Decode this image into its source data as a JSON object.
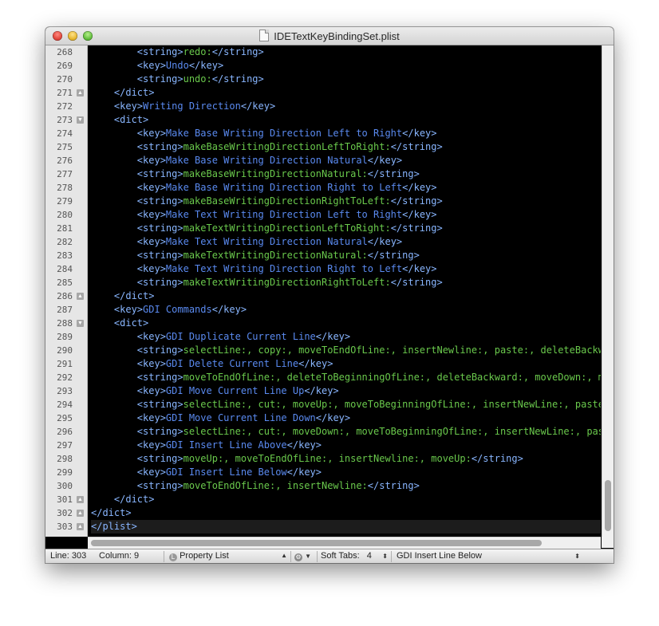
{
  "window": {
    "title": "IDETextKeyBindingSet.plist"
  },
  "editor": {
    "lines": [
      {
        "num": "268",
        "fold": "",
        "tokens": [
          {
            "t": "tag",
            "v": "        <string>"
          },
          {
            "t": "str",
            "v": "redo:"
          },
          {
            "t": "tag",
            "v": "</string>"
          }
        ]
      },
      {
        "num": "269",
        "fold": "",
        "tokens": [
          {
            "t": "tag",
            "v": "        <key>"
          },
          {
            "t": "txt",
            "v": "Undo"
          },
          {
            "t": "tag",
            "v": "</key>"
          }
        ]
      },
      {
        "num": "270",
        "fold": "",
        "tokens": [
          {
            "t": "tag",
            "v": "        <string>"
          },
          {
            "t": "str",
            "v": "undo:"
          },
          {
            "t": "tag",
            "v": "</string>"
          }
        ]
      },
      {
        "num": "271",
        "fold": "up",
        "tokens": [
          {
            "t": "tag",
            "v": "    </dict>"
          }
        ]
      },
      {
        "num": "272",
        "fold": "",
        "tokens": [
          {
            "t": "tag",
            "v": "    <key>"
          },
          {
            "t": "txt",
            "v": "Writing Direction"
          },
          {
            "t": "tag",
            "v": "</key>"
          }
        ]
      },
      {
        "num": "273",
        "fold": "down",
        "tokens": [
          {
            "t": "tag",
            "v": "    <dict>"
          }
        ]
      },
      {
        "num": "274",
        "fold": "",
        "tokens": [
          {
            "t": "tag",
            "v": "        <key>"
          },
          {
            "t": "txt",
            "v": "Make Base Writing Direction Left to Right"
          },
          {
            "t": "tag",
            "v": "</key>"
          }
        ]
      },
      {
        "num": "275",
        "fold": "",
        "tokens": [
          {
            "t": "tag",
            "v": "        <string>"
          },
          {
            "t": "str",
            "v": "makeBaseWritingDirectionLeftToRight:"
          },
          {
            "t": "tag",
            "v": "</string>"
          }
        ]
      },
      {
        "num": "276",
        "fold": "",
        "tokens": [
          {
            "t": "tag",
            "v": "        <key>"
          },
          {
            "t": "txt",
            "v": "Make Base Writing Direction Natural"
          },
          {
            "t": "tag",
            "v": "</key>"
          }
        ]
      },
      {
        "num": "277",
        "fold": "",
        "tokens": [
          {
            "t": "tag",
            "v": "        <string>"
          },
          {
            "t": "str",
            "v": "makeBaseWritingDirectionNatural:"
          },
          {
            "t": "tag",
            "v": "</string>"
          }
        ]
      },
      {
        "num": "278",
        "fold": "",
        "tokens": [
          {
            "t": "tag",
            "v": "        <key>"
          },
          {
            "t": "txt",
            "v": "Make Base Writing Direction Right to Left"
          },
          {
            "t": "tag",
            "v": "</key>"
          }
        ]
      },
      {
        "num": "279",
        "fold": "",
        "tokens": [
          {
            "t": "tag",
            "v": "        <string>"
          },
          {
            "t": "str",
            "v": "makeBaseWritingDirectionRightToLeft:"
          },
          {
            "t": "tag",
            "v": "</string>"
          }
        ]
      },
      {
        "num": "280",
        "fold": "",
        "tokens": [
          {
            "t": "tag",
            "v": "        <key>"
          },
          {
            "t": "txt",
            "v": "Make Text Writing Direction Left to Right"
          },
          {
            "t": "tag",
            "v": "</key>"
          }
        ]
      },
      {
        "num": "281",
        "fold": "",
        "tokens": [
          {
            "t": "tag",
            "v": "        <string>"
          },
          {
            "t": "str",
            "v": "makeTextWritingDirectionLeftToRight:"
          },
          {
            "t": "tag",
            "v": "</string>"
          }
        ]
      },
      {
        "num": "282",
        "fold": "",
        "tokens": [
          {
            "t": "tag",
            "v": "        <key>"
          },
          {
            "t": "txt",
            "v": "Make Text Writing Direction Natural"
          },
          {
            "t": "tag",
            "v": "</key>"
          }
        ]
      },
      {
        "num": "283",
        "fold": "",
        "tokens": [
          {
            "t": "tag",
            "v": "        <string>"
          },
          {
            "t": "str",
            "v": "makeTextWritingDirectionNatural:"
          },
          {
            "t": "tag",
            "v": "</string>"
          }
        ]
      },
      {
        "num": "284",
        "fold": "",
        "tokens": [
          {
            "t": "tag",
            "v": "        <key>"
          },
          {
            "t": "txt",
            "v": "Make Text Writing Direction Right to Left"
          },
          {
            "t": "tag",
            "v": "</key>"
          }
        ]
      },
      {
        "num": "285",
        "fold": "",
        "tokens": [
          {
            "t": "tag",
            "v": "        <string>"
          },
          {
            "t": "str",
            "v": "makeTextWritingDirectionRightToLeft:"
          },
          {
            "t": "tag",
            "v": "</string>"
          }
        ]
      },
      {
        "num": "286",
        "fold": "up",
        "tokens": [
          {
            "t": "tag",
            "v": "    </dict>"
          }
        ]
      },
      {
        "num": "287",
        "fold": "",
        "tokens": [
          {
            "t": "tag",
            "v": "    <key>"
          },
          {
            "t": "txt",
            "v": "GDI Commands"
          },
          {
            "t": "tag",
            "v": "</key>"
          }
        ]
      },
      {
        "num": "288",
        "fold": "down",
        "tokens": [
          {
            "t": "tag",
            "v": "    <dict>"
          }
        ]
      },
      {
        "num": "289",
        "fold": "",
        "tokens": [
          {
            "t": "tag",
            "v": "        <key>"
          },
          {
            "t": "txt",
            "v": "GDI Duplicate Current Line"
          },
          {
            "t": "tag",
            "v": "</key>"
          }
        ]
      },
      {
        "num": "290",
        "fold": "",
        "tokens": [
          {
            "t": "tag",
            "v": "        <string>"
          },
          {
            "t": "str",
            "v": "selectLine:, copy:, moveToEndOfLine:, insertNewline:, paste:, deleteBackw"
          }
        ]
      },
      {
        "num": "291",
        "fold": "",
        "tokens": [
          {
            "t": "tag",
            "v": "        <key>"
          },
          {
            "t": "txt",
            "v": "GDI Delete Current Line"
          },
          {
            "t": "tag",
            "v": "</key>"
          }
        ]
      },
      {
        "num": "292",
        "fold": "",
        "tokens": [
          {
            "t": "tag",
            "v": "        <string>"
          },
          {
            "t": "str",
            "v": "moveToEndOfLine:, deleteToBeginningOfLine:, deleteBackward:, moveDown:, m"
          }
        ]
      },
      {
        "num": "293",
        "fold": "",
        "tokens": [
          {
            "t": "tag",
            "v": "        <key>"
          },
          {
            "t": "txt",
            "v": "GDI Move Current Line Up"
          },
          {
            "t": "tag",
            "v": "</key>"
          }
        ]
      },
      {
        "num": "294",
        "fold": "",
        "tokens": [
          {
            "t": "tag",
            "v": "        <string>"
          },
          {
            "t": "str",
            "v": "selectLine:, cut:, moveUp:, moveToBeginningOfLine:, insertNewLine:, paste"
          }
        ]
      },
      {
        "num": "295",
        "fold": "",
        "tokens": [
          {
            "t": "tag",
            "v": "        <key>"
          },
          {
            "t": "txt",
            "v": "GDI Move Current Line Down"
          },
          {
            "t": "tag",
            "v": "</key>"
          }
        ]
      },
      {
        "num": "296",
        "fold": "",
        "tokens": [
          {
            "t": "tag",
            "v": "        <string>"
          },
          {
            "t": "str",
            "v": "selectLine:, cut:, moveDown:, moveToBeginningOfLine:, insertNewLine:, pas"
          }
        ]
      },
      {
        "num": "297",
        "fold": "",
        "tokens": [
          {
            "t": "tag",
            "v": "        <key>"
          },
          {
            "t": "txt",
            "v": "GDI Insert Line Above"
          },
          {
            "t": "tag",
            "v": "</key>"
          }
        ]
      },
      {
        "num": "298",
        "fold": "",
        "tokens": [
          {
            "t": "tag",
            "v": "        <string>"
          },
          {
            "t": "str",
            "v": "moveUp:, moveToEndOfLine:, insertNewline:, moveUp:"
          },
          {
            "t": "tag",
            "v": "</string>"
          }
        ]
      },
      {
        "num": "299",
        "fold": "",
        "tokens": [
          {
            "t": "tag",
            "v": "        <key>"
          },
          {
            "t": "txt",
            "v": "GDI Insert Line Below"
          },
          {
            "t": "tag",
            "v": "</key>"
          }
        ]
      },
      {
        "num": "300",
        "fold": "",
        "tokens": [
          {
            "t": "tag",
            "v": "        <string>"
          },
          {
            "t": "str",
            "v": "moveToEndOfLine:, insertNewline:"
          },
          {
            "t": "tag",
            "v": "</string>"
          }
        ]
      },
      {
        "num": "301",
        "fold": "up",
        "tokens": [
          {
            "t": "tag",
            "v": "    </dict>"
          }
        ]
      },
      {
        "num": "302",
        "fold": "up",
        "tokens": [
          {
            "t": "tag",
            "v": "</dict>"
          }
        ]
      },
      {
        "num": "303",
        "fold": "up",
        "current": true,
        "tokens": [
          {
            "t": "tag",
            "v": "</plist>"
          }
        ]
      }
    ]
  },
  "colors": {
    "tag": "#89b6ff",
    "text": "#5a8af0",
    "string": "#6ac94c",
    "background": "#000000"
  },
  "statusbar": {
    "line_label": "Line: 303",
    "column_label": "Column: 9",
    "syntax": "Property List",
    "tabs_label": "Soft Tabs:",
    "tabs_value": "4",
    "symbol": "GDI Insert Line Below"
  }
}
